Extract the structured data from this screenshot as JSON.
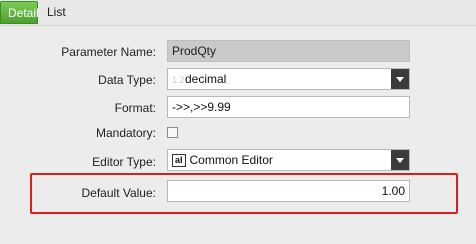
{
  "tabs": [
    {
      "label": "Detail",
      "active": true
    },
    {
      "label": "List",
      "active": false
    }
  ],
  "form": {
    "parameter_name": {
      "label": "Parameter Name:",
      "value": "ProdQty"
    },
    "data_type": {
      "label": "Data Type:",
      "icon_text": "1.2",
      "value": "decimal"
    },
    "format": {
      "label": "Format:",
      "value": "->>,>>9.99"
    },
    "mandatory": {
      "label": "Mandatory:",
      "checked": false
    },
    "editor_type": {
      "label": "Editor Type:",
      "icon_text": "aI",
      "value": "Common Editor"
    },
    "default_value": {
      "label": "Default Value:",
      "value": "1.00"
    }
  },
  "colors": {
    "active_tab": "#5aa93a",
    "highlight": "#e11b1b"
  }
}
